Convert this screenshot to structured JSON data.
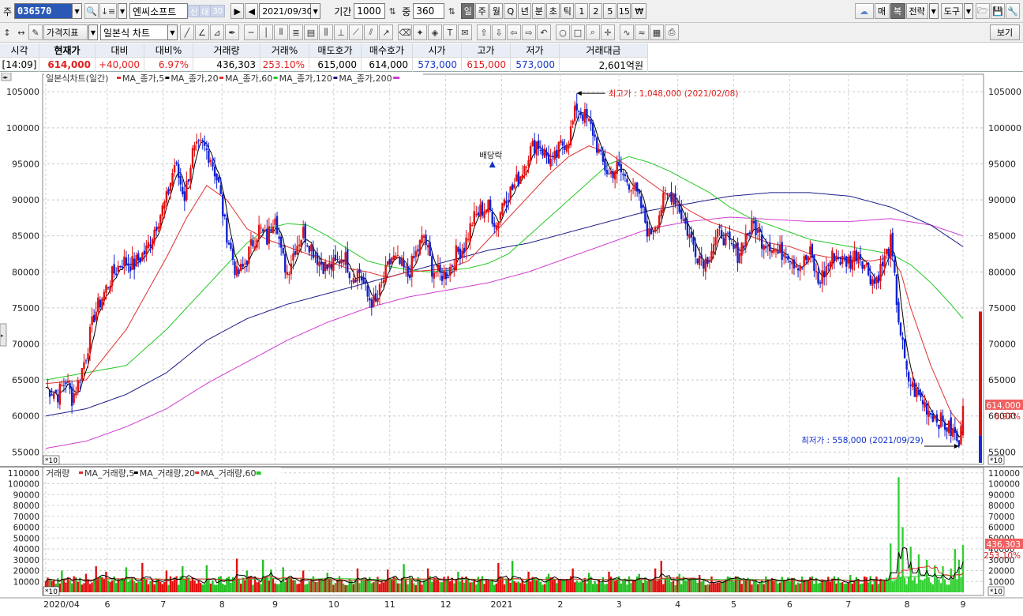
{
  "toolbar": {
    "jong_label": "주",
    "stock_code": "036570",
    "stock_name": "엔씨소프트",
    "tag_credit": "신",
    "tag_loan": "대",
    "tag_ratio": "30",
    "date": "2021/09/30",
    "period_label": "기간",
    "period_value": "1000",
    "count_label": "중",
    "count_value": "360",
    "periods": [
      "일",
      "주",
      "월",
      "Q",
      "년",
      "분",
      "초",
      "틱",
      "1",
      "2",
      "5",
      "15",
      "₩"
    ],
    "active_period": "일",
    "right_buttons": [
      "매",
      "복",
      "전략",
      "도구"
    ],
    "chart_type": "가격지표",
    "candle_type": "일본식 차트",
    "view_label": "보기"
  },
  "info_header": {
    "time_label": "시각",
    "time_value": "[14:09]",
    "price_label": "현재가",
    "price_value": "614,000",
    "change_label": "대비",
    "change_value": "+40,000",
    "pct_label": "대비%",
    "pct_value": "6.97%",
    "vol_label": "거래량",
    "vol_value": "436,303",
    "volpct_label": "거래%",
    "volpct_value": "253.10%",
    "ask_label": "매도호가",
    "ask_value": "615,000",
    "bid_label": "매수호가",
    "bid_value": "614,000",
    "open_label": "시가",
    "open_value": "573,000",
    "high_label": "고가",
    "high_value": "615,000",
    "low_label": "저가",
    "low_value": "573,000",
    "amt_label": "거래대금",
    "amt_value": "2,601억원"
  },
  "price_legend": {
    "title": "일본식차트(일간)",
    "items": [
      {
        "label": "MA_종가,5",
        "color": "#e03030"
      },
      {
        "label": "MA_종가,20",
        "color": "#000000"
      },
      {
        "label": "MA_종가,60",
        "color": "#e03030"
      },
      {
        "label": "MA_종가,120",
        "color": "#23c823"
      },
      {
        "label": "MA_종가,200",
        "color": "#1c1c88"
      }
    ],
    "ma200_swatch_color": "#d03cd0"
  },
  "volume_legend": {
    "title": "거래량",
    "items": [
      {
        "label": "MA_거래량,5",
        "color": "#e03030"
      },
      {
        "label": "MA_거래량,20",
        "color": "#000000"
      },
      {
        "label": "MA_거래량,60",
        "color": "#e03030"
      }
    ],
    "last_swatch_color": "#23c823"
  },
  "annotations": {
    "high": "최고가 : 1,048,000 (2021/02/08)",
    "low": "최저가 : 558,000 (2021/09/29)",
    "dividend": "배당락",
    "price_tag": "614,000",
    "pct_tag": "6.97%",
    "vol_tag": "436,303",
    "volpct_tag": "253.10%",
    "scale_tag": "*10"
  },
  "chart_data": {
    "type": "candlestick",
    "price_axis_ticks": [
      105000,
      100000,
      95000,
      90000,
      85000,
      80000,
      75000,
      70000,
      65000,
      60000,
      55000
    ],
    "price_ylim": [
      53500,
      107000
    ],
    "volume_axis_ticks": [
      110000,
      100000,
      90000,
      80000,
      70000,
      60000,
      50000,
      40000,
      30000,
      20000,
      10000
    ],
    "volume_ylim": [
      0,
      112000
    ],
    "x_labels": [
      "2020/04",
      "6",
      "7",
      "8",
      "9",
      "10",
      "11",
      "12",
      "2021",
      "2",
      "3",
      "4",
      "5",
      "6",
      "7",
      "8",
      "9"
    ],
    "close_path": [
      [
        0,
        64000
      ],
      [
        6,
        63000
      ],
      [
        10,
        65000
      ],
      [
        13,
        62500
      ],
      [
        16,
        64500
      ],
      [
        20,
        68500
      ],
      [
        24,
        74000
      ],
      [
        28,
        76500
      ],
      [
        33,
        79500
      ],
      [
        38,
        81500
      ],
      [
        44,
        81000
      ],
      [
        50,
        83000
      ],
      [
        56,
        87500
      ],
      [
        60,
        90000
      ],
      [
        64,
        95000
      ],
      [
        69,
        90500
      ],
      [
        73,
        96500
      ],
      [
        78,
        97500
      ],
      [
        82,
        96000
      ],
      [
        86,
        92000
      ],
      [
        89,
        86500
      ],
      [
        92,
        83000
      ],
      [
        95,
        79500
      ],
      [
        98,
        80500
      ],
      [
        102,
        83500
      ],
      [
        106,
        86000
      ],
      [
        110,
        84500
      ],
      [
        114,
        88500
      ],
      [
        117,
        82500
      ],
      [
        120,
        80000
      ],
      [
        124,
        83500
      ],
      [
        128,
        85500
      ],
      [
        132,
        83500
      ],
      [
        136,
        81500
      ],
      [
        140,
        80500
      ],
      [
        144,
        81000
      ],
      [
        148,
        82500
      ],
      [
        152,
        79500
      ],
      [
        156,
        80000
      ],
      [
        160,
        76500
      ],
      [
        164,
        75500
      ],
      [
        168,
        79000
      ],
      [
        172,
        82000
      ],
      [
        176,
        81000
      ],
      [
        180,
        79500
      ],
      [
        184,
        82500
      ],
      [
        188,
        85000
      ],
      [
        192,
        80500
      ],
      [
        196,
        79500
      ],
      [
        200,
        80000
      ],
      [
        204,
        82500
      ],
      [
        208,
        83500
      ],
      [
        212,
        87000
      ],
      [
        216,
        88500
      ],
      [
        220,
        89000
      ],
      [
        224,
        86500
      ],
      [
        228,
        90500
      ],
      [
        232,
        91500
      ],
      [
        236,
        93500
      ],
      [
        240,
        96500
      ],
      [
        244,
        98000
      ],
      [
        248,
        96500
      ],
      [
        252,
        95000
      ],
      [
        256,
        97500
      ],
      [
        260,
        98500
      ],
      [
        264,
        103000
      ],
      [
        268,
        101500
      ],
      [
        272,
        99500
      ],
      [
        276,
        95500
      ],
      [
        280,
        93500
      ],
      [
        284,
        94500
      ],
      [
        288,
        93000
      ],
      [
        292,
        92000
      ],
      [
        296,
        89000
      ],
      [
        300,
        85000
      ],
      [
        304,
        87500
      ],
      [
        308,
        90500
      ],
      [
        312,
        91000
      ],
      [
        316,
        88000
      ],
      [
        320,
        85000
      ],
      [
        324,
        82500
      ],
      [
        328,
        81500
      ],
      [
        332,
        84000
      ],
      [
        336,
        85500
      ],
      [
        340,
        83500
      ],
      [
        344,
        82500
      ],
      [
        348,
        85000
      ],
      [
        352,
        86500
      ],
      [
        356,
        84500
      ],
      [
        360,
        84000
      ],
      [
        364,
        82500
      ],
      [
        368,
        83000
      ],
      [
        372,
        81500
      ],
      [
        376,
        81000
      ],
      [
        380,
        82500
      ],
      [
        384,
        78500
      ],
      [
        388,
        80500
      ],
      [
        392,
        82500
      ],
      [
        396,
        81500
      ],
      [
        400,
        81500
      ],
      [
        404,
        83000
      ],
      [
        408,
        80500
      ],
      [
        412,
        78500
      ],
      [
        416,
        81000
      ],
      [
        420,
        84000
      ],
      [
        424,
        73500
      ],
      [
        428,
        65500
      ],
      [
        432,
        63500
      ],
      [
        436,
        62000
      ],
      [
        440,
        60500
      ],
      [
        444,
        59500
      ],
      [
        448,
        58500
      ],
      [
        452,
        57300
      ],
      [
        454,
        55800
      ],
      [
        456,
        61400
      ]
    ],
    "ma60_path": [
      [
        0,
        64500
      ],
      [
        20,
        65000
      ],
      [
        40,
        72000
      ],
      [
        60,
        82000
      ],
      [
        70,
        87500
      ],
      [
        80,
        92000
      ],
      [
        90,
        90000
      ],
      [
        100,
        86000
      ],
      [
        110,
        84500
      ],
      [
        120,
        83500
      ],
      [
        130,
        82500
      ],
      [
        140,
        81500
      ],
      [
        150,
        80500
      ],
      [
        160,
        80000
      ],
      [
        170,
        79200
      ],
      [
        180,
        80000
      ],
      [
        190,
        80200
      ],
      [
        200,
        80500
      ],
      [
        210,
        81500
      ],
      [
        220,
        84500
      ],
      [
        230,
        87500
      ],
      [
        240,
        90500
      ],
      [
        250,
        93500
      ],
      [
        260,
        96000
      ],
      [
        270,
        97500
      ],
      [
        280,
        96500
      ],
      [
        290,
        94500
      ],
      [
        300,
        92500
      ],
      [
        310,
        90500
      ],
      [
        320,
        88500
      ],
      [
        330,
        87000
      ],
      [
        340,
        86000
      ],
      [
        350,
        85000
      ],
      [
        360,
        84000
      ],
      [
        370,
        83500
      ],
      [
        380,
        82500
      ],
      [
        390,
        82000
      ],
      [
        400,
        82000
      ],
      [
        410,
        81500
      ],
      [
        420,
        82000
      ],
      [
        425,
        80000
      ],
      [
        430,
        75000
      ],
      [
        440,
        67000
      ],
      [
        450,
        60500
      ],
      [
        456,
        58500
      ]
    ],
    "ma120_path": [
      [
        0,
        65000
      ],
      [
        40,
        67000
      ],
      [
        60,
        72000
      ],
      [
        80,
        78000
      ],
      [
        100,
        84000
      ],
      [
        110,
        86000
      ],
      [
        120,
        86700
      ],
      [
        130,
        86500
      ],
      [
        140,
        85000
      ],
      [
        150,
        83200
      ],
      [
        160,
        81500
      ],
      [
        170,
        80800
      ],
      [
        180,
        80300
      ],
      [
        190,
        80000
      ],
      [
        200,
        80200
      ],
      [
        210,
        80500
      ],
      [
        220,
        81200
      ],
      [
        230,
        82500
      ],
      [
        240,
        85000
      ],
      [
        250,
        87500
      ],
      [
        260,
        90000
      ],
      [
        270,
        92500
      ],
      [
        280,
        95000
      ],
      [
        290,
        96000
      ],
      [
        300,
        95200
      ],
      [
        310,
        94000
      ],
      [
        320,
        92500
      ],
      [
        330,
        91000
      ],
      [
        340,
        89000
      ],
      [
        350,
        87500
      ],
      [
        360,
        86500
      ],
      [
        370,
        85500
      ],
      [
        380,
        84500
      ],
      [
        390,
        84000
      ],
      [
        400,
        83500
      ],
      [
        410,
        83000
      ],
      [
        420,
        82500
      ],
      [
        430,
        81000
      ],
      [
        440,
        78500
      ],
      [
        450,
        75500
      ],
      [
        456,
        73500
      ]
    ],
    "ma200_path": [
      [
        0,
        60000
      ],
      [
        20,
        61000
      ],
      [
        40,
        63000
      ],
      [
        60,
        66000
      ],
      [
        80,
        70500
      ],
      [
        100,
        73500
      ],
      [
        120,
        75500
      ],
      [
        140,
        77000
      ],
      [
        160,
        78500
      ],
      [
        180,
        80000
      ],
      [
        200,
        81500
      ],
      [
        220,
        83000
      ],
      [
        240,
        84000
      ],
      [
        260,
        85500
      ],
      [
        280,
        87000
      ],
      [
        300,
        88500
      ],
      [
        320,
        89500
      ],
      [
        340,
        90500
      ],
      [
        360,
        91000
      ],
      [
        380,
        91000
      ],
      [
        400,
        90500
      ],
      [
        420,
        89000
      ],
      [
        440,
        86500
      ],
      [
        456,
        83500
      ]
    ],
    "ma_pink_path": [
      [
        0,
        55500
      ],
      [
        20,
        56500
      ],
      [
        40,
        58500
      ],
      [
        60,
        61000
      ],
      [
        80,
        64500
      ],
      [
        100,
        67500
      ],
      [
        120,
        70500
      ],
      [
        140,
        73000
      ],
      [
        160,
        75000
      ],
      [
        180,
        76500
      ],
      [
        200,
        77500
      ],
      [
        220,
        78500
      ],
      [
        240,
        80000
      ],
      [
        260,
        82000
      ],
      [
        280,
        84000
      ],
      [
        300,
        86000
      ],
      [
        320,
        87000
      ],
      [
        340,
        87600
      ],
      [
        360,
        87300
      ],
      [
        380,
        87000
      ],
      [
        400,
        87000
      ],
      [
        420,
        87400
      ],
      [
        440,
        86500
      ],
      [
        456,
        85000
      ]
    ],
    "volume_base": 12000,
    "volume_spikes": [
      [
        8,
        20000
      ],
      [
        20,
        17000
      ],
      [
        25,
        24000
      ],
      [
        30,
        19000
      ],
      [
        40,
        23000
      ],
      [
        48,
        27000
      ],
      [
        60,
        20000
      ],
      [
        68,
        24000
      ],
      [
        80,
        25000
      ],
      [
        95,
        31000
      ],
      [
        100,
        20000
      ],
      [
        108,
        30000
      ],
      [
        112,
        21000
      ],
      [
        118,
        23000
      ],
      [
        128,
        20000
      ],
      [
        140,
        18000
      ],
      [
        155,
        22000
      ],
      [
        170,
        21000
      ],
      [
        178,
        26000
      ],
      [
        190,
        22000
      ],
      [
        205,
        19000
      ],
      [
        225,
        27000
      ],
      [
        232,
        29000
      ],
      [
        240,
        19000
      ],
      [
        250,
        17000
      ],
      [
        262,
        22000
      ],
      [
        270,
        18000
      ],
      [
        280,
        19000
      ],
      [
        295,
        17000
      ],
      [
        303,
        22000
      ],
      [
        306,
        29000
      ],
      [
        315,
        17000
      ],
      [
        325,
        16000
      ],
      [
        345,
        13000
      ],
      [
        380,
        14000
      ],
      [
        400,
        16000
      ],
      [
        410,
        15000
      ],
      [
        420,
        45000
      ],
      [
        424,
        106000
      ],
      [
        426,
        60000
      ],
      [
        430,
        42000
      ],
      [
        434,
        35000
      ],
      [
        438,
        30000
      ],
      [
        442,
        25000
      ],
      [
        446,
        24000
      ],
      [
        450,
        22000
      ],
      [
        452,
        40000
      ],
      [
        454,
        30000
      ],
      [
        456,
        43630
      ]
    ]
  }
}
